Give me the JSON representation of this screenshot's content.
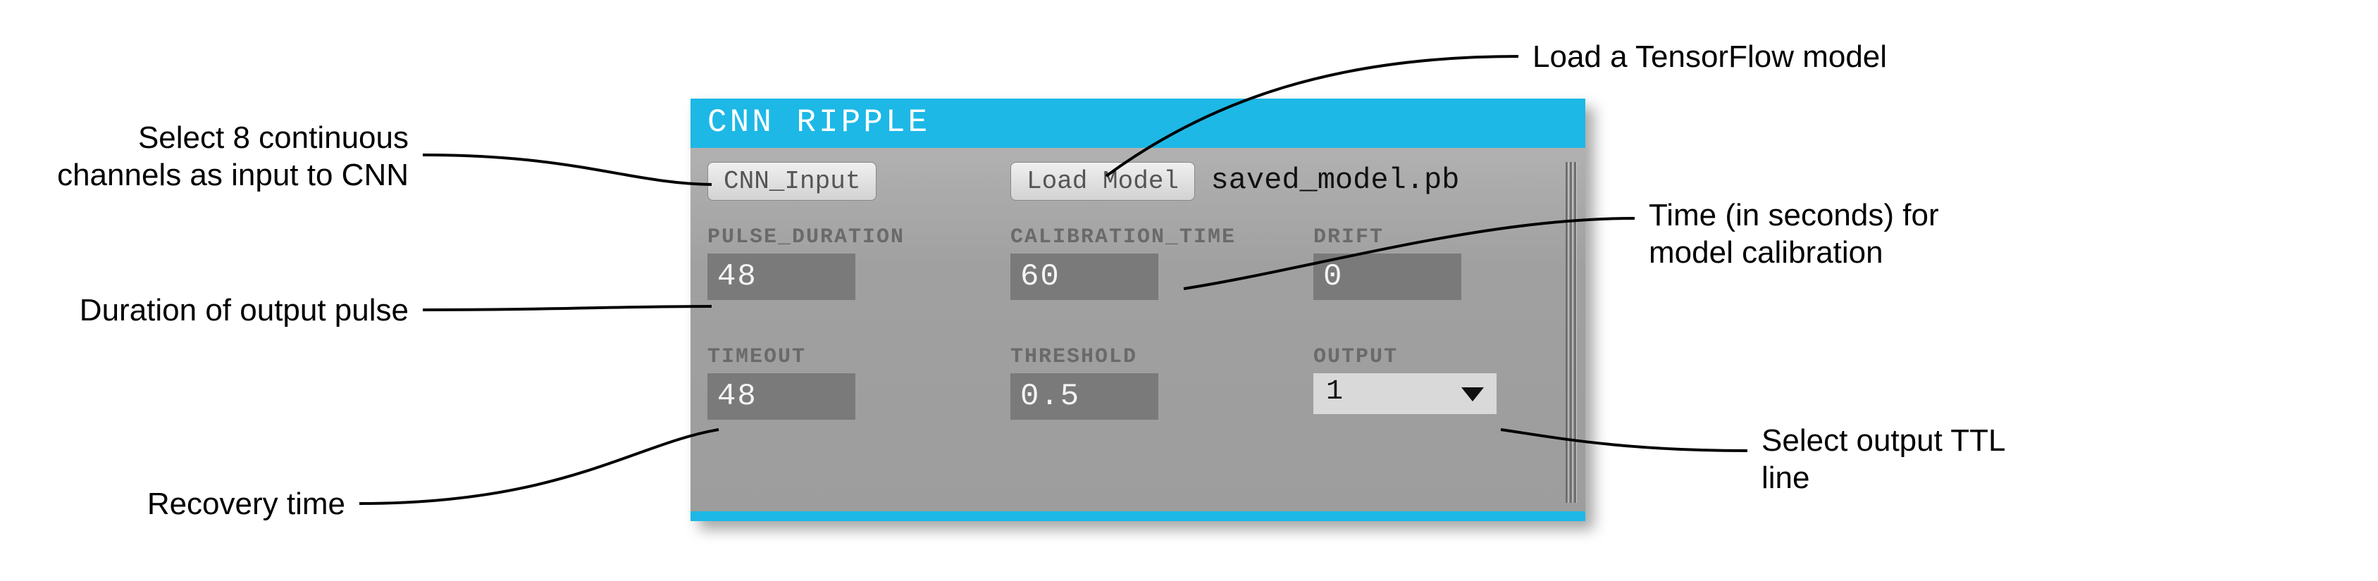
{
  "panel": {
    "title": "CNN RIPPLE",
    "buttons": {
      "cnn_input": "CNN_Input",
      "load_model": "Load Model"
    },
    "model_path": "saved_model.pb",
    "fields": {
      "pulse_duration": {
        "label": "PULSE_DURATION",
        "value": "48"
      },
      "calibration_time": {
        "label": "CALIBRATION_TIME",
        "value": "60"
      },
      "drift": {
        "label": "DRIFT",
        "value": "0"
      },
      "timeout": {
        "label": "TIMEOUT",
        "value": "48"
      },
      "threshold": {
        "label": "THRESHOLD",
        "value": "0.5"
      },
      "output": {
        "label": "OUTPUT",
        "value": "1"
      }
    }
  },
  "annotations": {
    "cnn_input": "Select 8 continuous channels as input to CNN",
    "load_model": "Load a TensorFlow model",
    "pulse_duration": "Duration of output pulse",
    "calibration_time": "Time (in seconds) for model calibration",
    "timeout": "Recovery time",
    "output": "Select output TTL line"
  }
}
